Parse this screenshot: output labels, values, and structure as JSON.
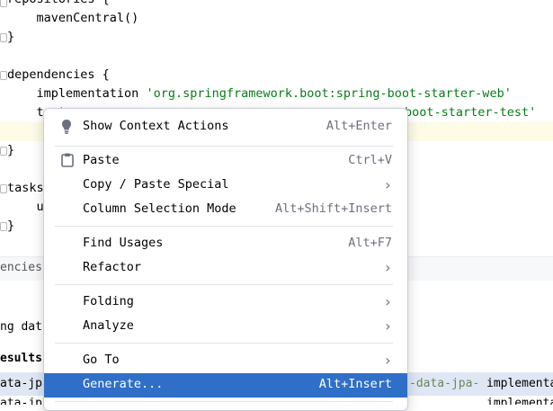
{
  "editor": {
    "lines": [
      {
        "text": "repositories {"
      },
      {
        "text": "    mavenCentral()"
      },
      {
        "text": "}"
      },
      {
        "text": ""
      },
      {
        "text": "dependencies {"
      },
      {
        "kw": "    implementation ",
        "str": "'org.springframework.boot:spring-boot-starter-web'"
      },
      {
        "kw": "    test",
        "str": "boot-starter-test'"
      },
      {
        "text": "}"
      },
      {
        "text": ""
      },
      {
        "text": "tasks"
      },
      {
        "text": "    u"
      },
      {
        "text": "}"
      }
    ]
  },
  "breadcrumb": "encies{",
  "panel": {
    "row1": "ng dat",
    "row2": "esults",
    "row3_left": "ata-jpa",
    "row3_mid": "-data-jpa-",
    "row3_right": "implementa",
    "row4_left": "ata-jp",
    "row4_right": "implementa"
  },
  "context_menu": {
    "items": [
      {
        "label": "Show Context Actions",
        "shortcut": "Alt+Enter",
        "icon": "bulb-icon"
      },
      {
        "label": "Paste",
        "shortcut": "Ctrl+V",
        "icon": "clipboard-icon"
      },
      {
        "label": "Copy / Paste Special",
        "submenu": true
      },
      {
        "label": "Column Selection Mode",
        "shortcut": "Alt+Shift+Insert"
      },
      {
        "label": "Find Usages",
        "shortcut": "Alt+F7"
      },
      {
        "label": "Refactor",
        "submenu": true
      },
      {
        "label": "Folding",
        "submenu": true
      },
      {
        "label": "Analyze",
        "submenu": true
      },
      {
        "label": "Go To",
        "submenu": true
      },
      {
        "label": "Generate...",
        "shortcut": "Alt+Insert",
        "selected": true
      }
    ]
  },
  "colors": {
    "accent": "#2f6fc7",
    "string": "#067d17",
    "line_highlight": "#fefbe6"
  }
}
